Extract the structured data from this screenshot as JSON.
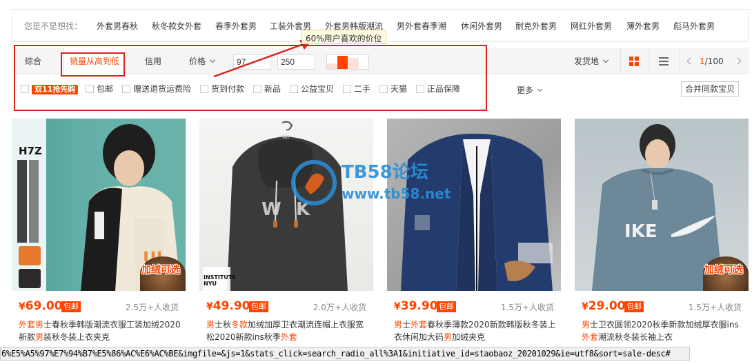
{
  "suggest": {
    "label": "您是不是想找：",
    "items": [
      "外套男春秋",
      "秋冬款女外套",
      "春季外套男",
      "工装外套男",
      "外套男韩版潮流",
      "男外套春季潮",
      "休闲外套男",
      "耐克外套男",
      "网红外套男",
      "薄外套男",
      "彪马外套男"
    ]
  },
  "tooltip": "60%用户喜欢的价位",
  "sort": {
    "comprehensive": "综合",
    "sales_desc": "销量从高到低",
    "credit": "信用",
    "price": "价格",
    "price_min": "97",
    "price_sep": "-",
    "price_max": "250",
    "ship_from": "发货地",
    "pager": {
      "current": "1",
      "total": "/100"
    }
  },
  "filters": {
    "badge_11": "双11抢先购",
    "items": [
      "包邮",
      "赠送退货运费险",
      "货到付款",
      "新品",
      "公益宝贝",
      "二手",
      "天猫",
      "正品保障"
    ],
    "more": "更多",
    "merge": "合并同款宝贝"
  },
  "products": [
    {
      "price_symbol": "¥",
      "price": "69.00",
      "free_ship": "包邮",
      "sales": "2.5万+人收货",
      "title_parts": [
        {
          "t": "外套",
          "hl": true
        },
        {
          "t": "男",
          "hl": true
        },
        {
          "t": "士春秋季韩版潮流衣服工装加绒",
          "hl": false
        },
        {
          "t": "2020新款",
          "hl": false
        },
        {
          "t": "男",
          "hl": true
        },
        {
          "t": "装秋冬装上衣夹克",
          "hl": false
        }
      ],
      "overlay": "加绒可选",
      "brand": "H7Z"
    },
    {
      "price_symbol": "¥",
      "price": "49.90",
      "free_ship": "包邮",
      "sales": "2.0万+人收货",
      "title_parts": [
        {
          "t": "男",
          "hl": true
        },
        {
          "t": "士秋",
          "hl": false
        },
        {
          "t": "冬款",
          "hl": true
        },
        {
          "t": "加绒加厚卫衣潮流连帽上衣服宽松2020新款ins秋季",
          "hl": false
        },
        {
          "t": "外套",
          "hl": true
        }
      ],
      "overlay": "",
      "brand": "INSTITUTE NYU"
    },
    {
      "price_symbol": "¥",
      "price": "39.90",
      "free_ship": "包邮",
      "sales": "1.5万+人收货",
      "title_parts": [
        {
          "t": "男",
          "hl": true
        },
        {
          "t": "士",
          "hl": false
        },
        {
          "t": "外套",
          "hl": true
        },
        {
          "t": "春秋季薄款2020新款韩版秋冬装上衣休闲加大码",
          "hl": false
        },
        {
          "t": "男",
          "hl": true
        },
        {
          "t": "加绒夹克",
          "hl": false
        }
      ],
      "overlay": "",
      "brand": ""
    },
    {
      "price_symbol": "¥",
      "price": "29.00",
      "free_ship": "包邮",
      "sales": "1.5万+人收货",
      "title_parts": [
        {
          "t": "男",
          "hl": true
        },
        {
          "t": "士卫衣圆领2020秋季新款加绒厚衣服ins",
          "hl": false
        },
        {
          "t": "外套",
          "hl": true
        },
        {
          "t": "潮流秋冬装长袖上衣",
          "hl": false
        }
      ],
      "overlay": "加绒可选",
      "brand": "IKE"
    }
  ],
  "watermark": {
    "title": "TB58论坛",
    "url": "www.tb58.net"
  },
  "statusbar": "6%E5%A5%97%E7%94%B7%E5%86%AC%E6%AC%BE&imgfile=&js=1&stats_click=search_radio_all%3A1&initiative_id=staobaoz_20201029&ie=utf8&sort=sale-desc#",
  "colors": {
    "accent": "#ff4400",
    "annotation": "#e0201b",
    "watermark": "#2a8fd8"
  }
}
